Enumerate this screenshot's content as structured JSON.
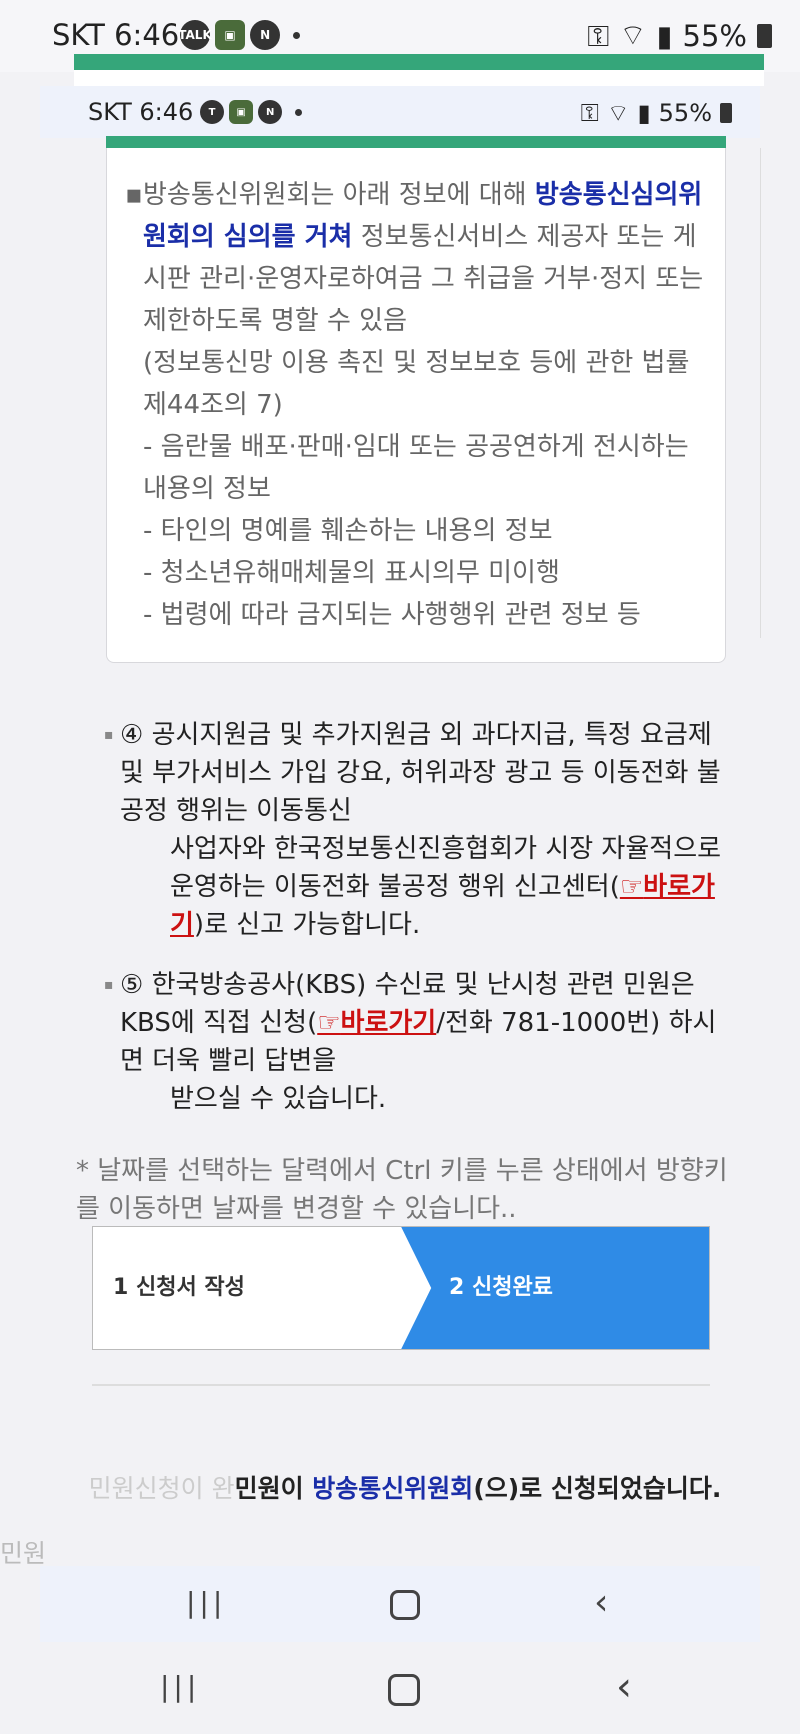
{
  "status_bar": {
    "carrier_time": "SKT 6:46",
    "battery": "55%"
  },
  "inner_status_bar": {
    "carrier_time": "SKT 6:46",
    "battery": "55%"
  },
  "info_box": {
    "line1_pre": "방송통신위원회는 아래 정보에 대해 ",
    "line1_highlight": "방송통신심의위원회의 심의를 거쳐",
    "line1_post": " 정보통신서비스 제공자 또는 게시판 관리·운영자로하여금 그 취급을 거부·정지 또는 제한하도록 명할 수 있음",
    "law_ref": "(정보통신망 이용 촉진 및 정보보호 등에 관한 법률 제44조의 7)",
    "items": [
      "- 음란물 배포·판매·임대 또는 공공연하게 전시하는 내용의 정보",
      "- 타인의 명예를 훼손하는 내용의 정보",
      "- 청소년유해매체물의 표시의무 미이행",
      "- 법령에 따라 금지되는 사행행위 관련 정보 등"
    ]
  },
  "notice4": {
    "part1": "④ 공시지원금 및 추가지원금 외 과다지급, 특정 요금제 및 부가서비스 가입 강요, 허위과장 광고 등 이동전화 불공정 행위는 이동통신",
    "part2": "사업자와 한국정보통신진흥협회가 시장 자율적으로 운영하는 이동전화 불공정 행위 신고센터(",
    "link_hand": "☞",
    "link": "바로가기",
    "part3": ")로 신고 가능합니다."
  },
  "notice5": {
    "part1": "⑤ 한국방송공사(KBS) 수신료 및 난시청 관련 민원은 KBS에 직접 신청(",
    "link_hand": "☞",
    "link": "바로가기",
    "part2": "/전화 781-1000번) 하시면 더욱 빨리 답변을",
    "part3": "받으실 수 있습니다."
  },
  "hint": "* 날짜를 선택하는 달력에서 Ctrl 키를 누른 상태에서 방향키를 이동하면 날짜를 변경할 수 있습니다..",
  "steps": {
    "step1": "1 신청서 작성",
    "step2": "2 신청완료",
    "active_color": "#2f8be6"
  },
  "result": {
    "ghost_prefix": "민원신청이 완",
    "pre": "민원이 ",
    "org": "방송통신위원회",
    "post": "(으)로 신청되었습니다."
  },
  "left_ghost": "민원"
}
